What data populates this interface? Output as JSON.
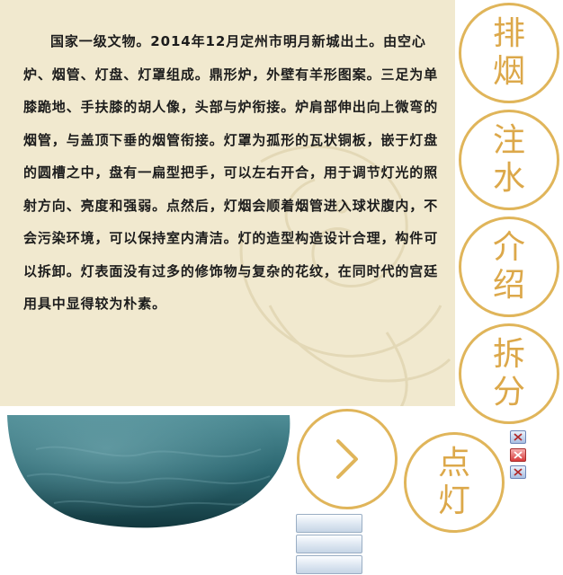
{
  "description": {
    "text": "国家一级文物。2014年12月定州市明月新城出土。由空心炉、烟管、灯盘、灯罩组成。鼎形炉，外壁有羊形图案。三足为单膝跪地、手扶膝的胡人像，头部与炉衔接。炉肩部伸出向上微弯的烟管，与盖顶下垂的烟管衔接。灯罩为孤形的瓦状铜板，嵌于灯盘的圆槽之中，盘有一扁型把手，可以左右开合，用于调节灯光的照射方向、亮度和强弱。点然后，灯烟会顺着烟管进入球状腹内，不会污染环境，可以保持室内清洁。灯的造型构造设计合理，构件可以拆卸。灯表面没有过多的修饰物与复杂的花纹，在同时代的宫廷用具中显得较为朴素。"
  },
  "nav": {
    "exhaust": "排烟",
    "water": "注水",
    "intro": "介绍",
    "disassemble": "拆分",
    "light": "点灯"
  },
  "colors": {
    "panel_bg": "#f1e9cf",
    "ring": "#e0b55a",
    "glyph": "#dca84a",
    "bowl_light": "#4f8d96",
    "bowl_dark": "#12383e"
  },
  "icons": {
    "next": "chevron-right-icon",
    "close": "close-icon"
  }
}
